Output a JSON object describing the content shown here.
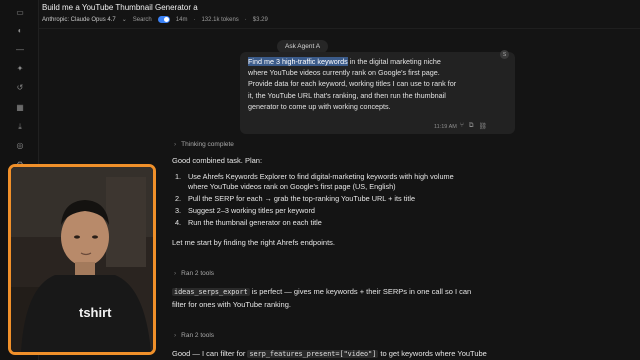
{
  "header": {
    "title": "Build me a YouTube Thumbnail Generator a",
    "model": "Anthropic: Claude Opus 4.7",
    "search_label": "Search",
    "duration": "14m",
    "tokens": "132.1k tokens",
    "cost": "$3.29"
  },
  "conversation": {
    "agent_pill": "Ask Agent A",
    "user_message": {
      "highlight": "Find me 3 high-traffic keywords",
      "text_line1_rest": " in the digital marketing niche",
      "line2": "where YouTube videos currently rank on Google's first page.",
      "line3": "Provide data for each keyword, working titles I can use to rank for",
      "line4": "it, the YouTube URL that's ranking, and then run the thumbnail",
      "line5": "generator to come up with working concepts.",
      "time": "11:19 AM"
    },
    "thinking_label": "Thinking complete",
    "intro": "Good combined task. Plan:",
    "plan": [
      {
        "num": "1.",
        "lines": [
          "Use Ahrefs Keywords Explorer to find digital-marketing keywords with high volume",
          "where YouTube videos rank on Google's first page (US, English)"
        ]
      },
      {
        "num": "2.",
        "lines": [
          "Pull the SERP for each → grab the top-ranking YouTube URL + its title"
        ]
      },
      {
        "num": "3.",
        "lines": [
          "Suggest 2–3 working titles per keyword"
        ]
      },
      {
        "num": "4.",
        "lines": [
          "Run the thumbnail generator on each title"
        ]
      }
    ],
    "start_line": "Let me start by finding the right Ahrefs endpoints.",
    "ran_tools_1": "Ran 2 tools",
    "tool_code": "ideas_serps_export",
    "tool_text_a": " is perfect — gives me keywords + their SERPs in one call so I can",
    "tool_text_b": "filter for ones with YouTube ranking.",
    "ran_tools_2": "Ran 2 tools",
    "last_prefix": "Good — I can filter for ",
    "last_code": "serp_features_present=[\"video\"]",
    "last_suffix": " to get keywords where YouTube"
  },
  "webcam": {
    "shirt_text": "tshirt"
  },
  "colors": {
    "background": "#141414",
    "highlight": "#3b5b8a",
    "webcam_border": "#f0902a",
    "toggle": "#3b82f6"
  }
}
